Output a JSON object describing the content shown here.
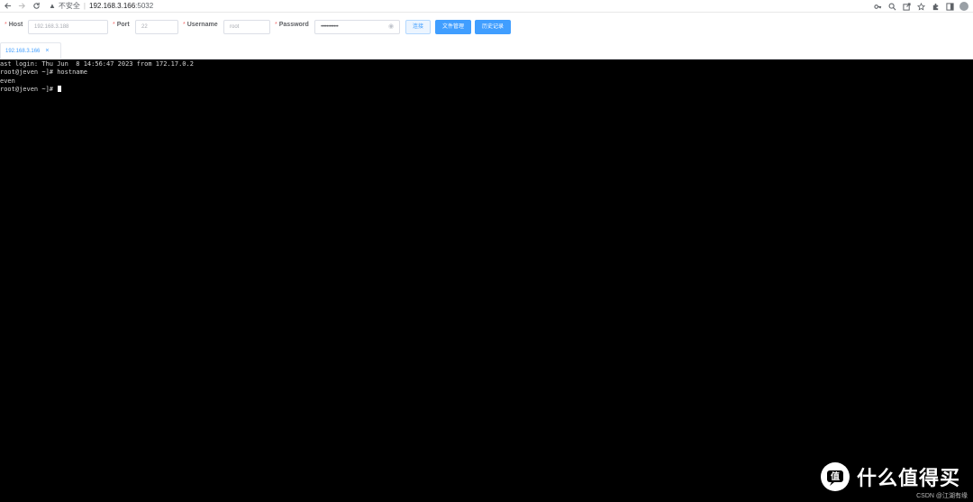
{
  "browser": {
    "security_label": "不安全",
    "url_host": "192.168.3.166",
    "url_port": ":5032"
  },
  "form": {
    "host": {
      "label": "Host",
      "required_mark": "*",
      "placeholder": "192.168.3.188"
    },
    "port": {
      "label": "Port",
      "required_mark": "*",
      "placeholder": "22"
    },
    "username": {
      "label": "Username",
      "required_mark": "*",
      "placeholder": "root"
    },
    "password": {
      "label": "Password",
      "required_mark": "*",
      "value_masked": "••••••••••••"
    },
    "buttons": {
      "connect": "连接",
      "file_manager": "文件管理",
      "history": "历史记录"
    }
  },
  "tabs": [
    {
      "label": "192.168.3.166",
      "close": "×"
    }
  ],
  "terminal": {
    "lines": [
      "ast login: Thu Jun  8 14:56:47 2023 from 172.17.0.2",
      "root@jeven ~]# hostname",
      "even",
      "root@jeven ~]# "
    ]
  },
  "watermark": {
    "text": "什么值得买",
    "credit": "CSDN @江湖有缘"
  },
  "colors": {
    "accent": "#409eff",
    "required": "#f56c6c",
    "terminal_bg": "#000000"
  }
}
